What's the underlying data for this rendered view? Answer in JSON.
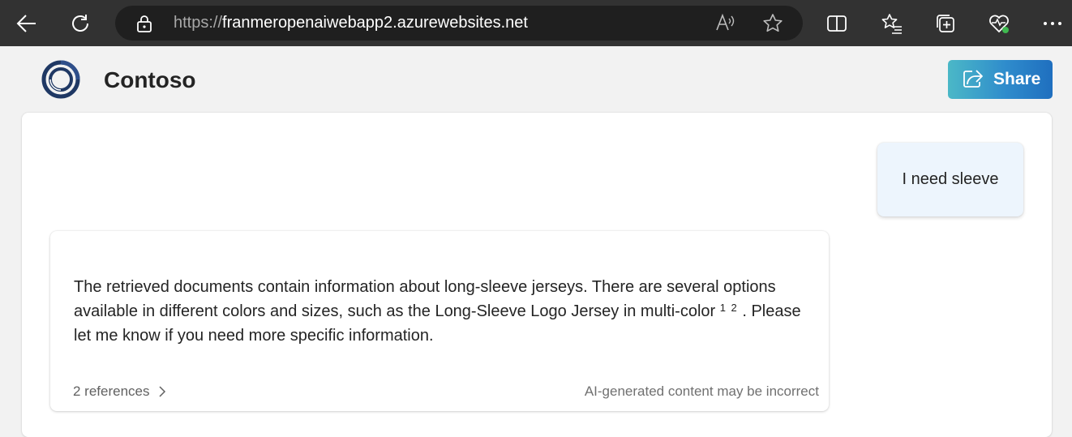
{
  "browser": {
    "url_protocol": "https://",
    "url_host": "franmeropenaiwebapp2.azurewebsites.net"
  },
  "header": {
    "brand": "Contoso",
    "share_label": "Share",
    "accent_gradient": [
      "#4bb8c7",
      "#1f6fbf"
    ]
  },
  "chat": {
    "user_message": "I need sleeve",
    "answer": {
      "text_part1": "The retrieved documents contain information about long-sleeve jerseys. There are several options available in different colors and sizes, such as the Long-Sleeve Logo Jersey in multi-color ",
      "citations": [
        "1",
        "2"
      ],
      "text_part2": ". Please let me know if you need more specific information.",
      "references_label": "2 references",
      "disclaimer": "AI-generated content may be incorrect"
    }
  }
}
